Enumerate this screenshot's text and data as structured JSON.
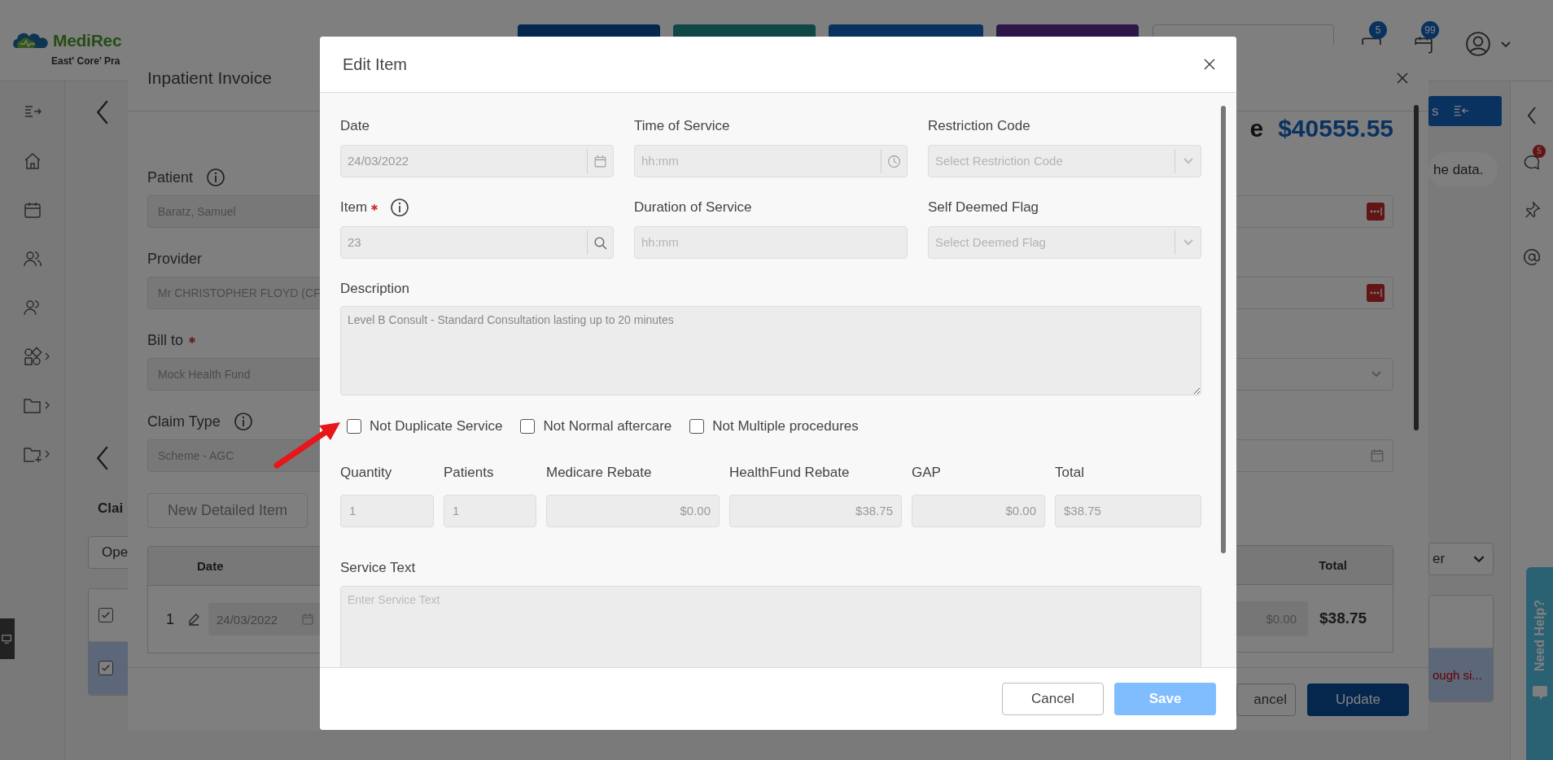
{
  "app": {
    "logo_text": "MediRec",
    "practice": "East' Core' Pra",
    "message_badge": "5",
    "calendar_badge": "99"
  },
  "page": {
    "claims_label": "Clai",
    "dropdown_left": "Ope",
    "dropdown_right": "er",
    "hint": "he data.",
    "toolbar_button": "s",
    "rows": [
      {
        "checked": true,
        "selected": false
      },
      {
        "checked": true,
        "selected": true,
        "note": "ough si..."
      }
    ]
  },
  "right_rail": {
    "chat_badge": "5"
  },
  "help_tab": {
    "label": "Need Help?"
  },
  "invoice": {
    "title": "Inpatient Invoice",
    "balance_label": "e",
    "balance": "$40555.55",
    "fields": [
      {
        "label": "Patient",
        "info": true,
        "required": false,
        "value": "Baratz, Samuel"
      },
      {
        "label": "Provider",
        "info": false,
        "required": false,
        "value": "Mr CHRISTOPHER FLOYD (CF"
      },
      {
        "label": "Bill to",
        "info": false,
        "required": true,
        "value": "Mock Health Fund"
      },
      {
        "label": "Claim Type",
        "info": true,
        "required": false,
        "value": "Scheme - AGC"
      }
    ],
    "new_item_button": "New Detailed Item",
    "table": {
      "columns": [
        "Date",
        "Total"
      ],
      "rows": [
        {
          "number": "1",
          "date": "24/03/2022",
          "gap": "$0.00",
          "total": "$38.75"
        }
      ]
    },
    "buttons": [
      {
        "label": "ancel",
        "kind": "secondary"
      },
      {
        "label": "Update",
        "kind": "primary"
      }
    ]
  },
  "edit_item": {
    "title": "Edit Item",
    "fields": [
      {
        "label": "Date",
        "required": false,
        "info": false,
        "kind": "date",
        "value": "24/03/2022"
      },
      {
        "label": "Time of Service",
        "required": false,
        "info": false,
        "kind": "time",
        "placeholder": "hh:mm"
      },
      {
        "label": "Restriction Code",
        "required": false,
        "info": false,
        "kind": "select",
        "placeholder": "Select Restriction Code"
      },
      {
        "label": "Item",
        "required": true,
        "info": true,
        "kind": "search",
        "value": "23"
      },
      {
        "label": "Duration of Service",
        "required": false,
        "info": false,
        "kind": "text",
        "placeholder": "hh:mm"
      },
      {
        "label": "Self Deemed Flag",
        "required": false,
        "info": false,
        "kind": "select",
        "placeholder": "Select Deemed Flag"
      }
    ],
    "description": {
      "label": "Description",
      "value": "Level B Consult - Standard Consultation lasting up to 20 minutes"
    },
    "checkboxes": [
      {
        "label": "Not Duplicate Service",
        "checked": false
      },
      {
        "label": "Not Normal aftercare",
        "checked": false
      },
      {
        "label": "Not Multiple procedures",
        "checked": false
      }
    ],
    "amounts": [
      {
        "label": "Quantity",
        "value": "1",
        "kind": "count"
      },
      {
        "label": "Patients",
        "value": "1",
        "kind": "count"
      },
      {
        "label": "Medicare Rebate",
        "value": "$0.00",
        "kind": "money"
      },
      {
        "label": "HealthFund Rebate",
        "value": "$38.75",
        "kind": "money"
      },
      {
        "label": "GAP",
        "value": "$0.00",
        "kind": "money"
      },
      {
        "label": "Total",
        "value": "$38.75",
        "kind": "count"
      }
    ],
    "service_text": {
      "label": "Service Text",
      "placeholder": "Enter Service Text"
    },
    "buttons": [
      {
        "label": "Cancel",
        "kind": "secondary",
        "disabled": false
      },
      {
        "label": "Save",
        "kind": "primary",
        "disabled": true
      }
    ]
  }
}
